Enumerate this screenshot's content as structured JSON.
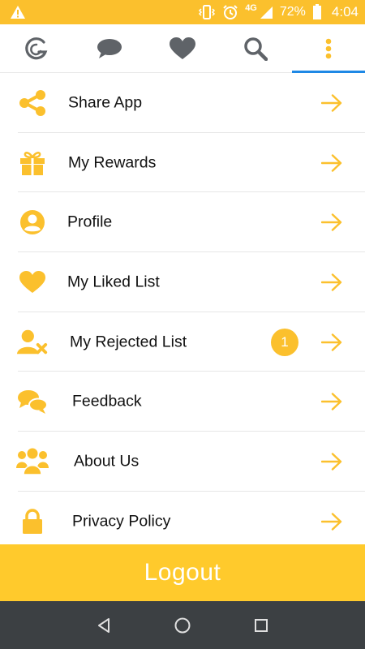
{
  "status_bar": {
    "network": "4G",
    "battery": "72%",
    "time": "4:04"
  },
  "tabs": [
    {
      "icon": "app-logo-icon",
      "active": false
    },
    {
      "icon": "chat-bubble-icon",
      "active": false
    },
    {
      "icon": "heart-icon",
      "active": false
    },
    {
      "icon": "search-icon",
      "active": false
    },
    {
      "icon": "more-vertical-icon",
      "active": true
    }
  ],
  "menu": {
    "items": [
      {
        "label": "Share App",
        "icon": "share-icon"
      },
      {
        "label": "My Rewards",
        "icon": "gift-icon"
      },
      {
        "label": "Profile",
        "icon": "profile-icon"
      },
      {
        "label": "My Liked List",
        "icon": "heart-icon"
      },
      {
        "label": "My Rejected List",
        "icon": "user-rejected-icon",
        "badge": "1"
      },
      {
        "label": "Feedback",
        "icon": "feedback-icon"
      },
      {
        "label": "About Us",
        "icon": "group-icon"
      },
      {
        "label": "Privacy Policy",
        "icon": "lock-icon"
      }
    ]
  },
  "logout": {
    "label": "Logout"
  },
  "colors": {
    "accent": "#FBC02D",
    "logout_bg": "#FFCA2C",
    "tab_indicator": "#1E88E5",
    "tab_icon": "#5f6368",
    "nav_bar": "#3c4043"
  }
}
